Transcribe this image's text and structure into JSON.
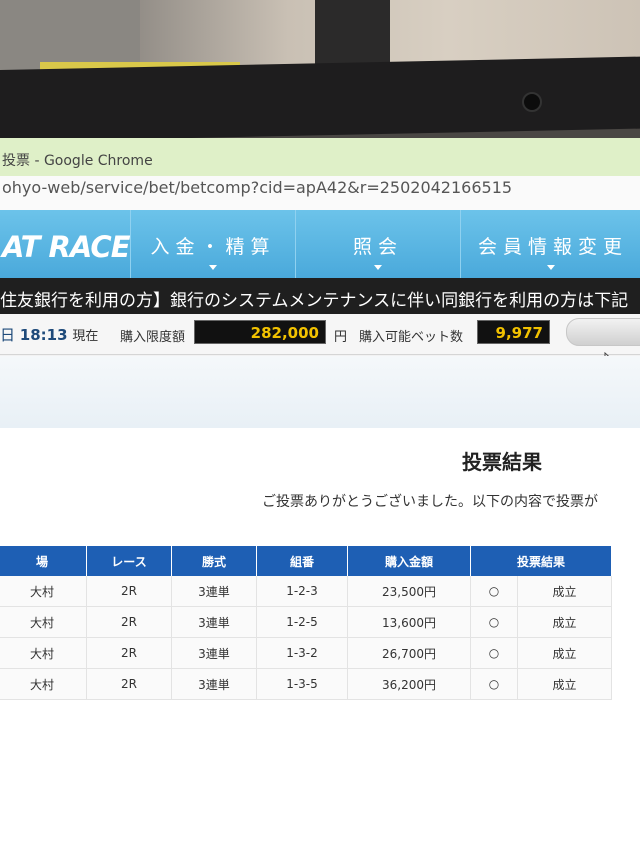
{
  "window": {
    "title": "投票 - Google Chrome",
    "url": "ohyo-web/service/bet/betcomp?cid=apA42&r=2502042166515"
  },
  "site": {
    "logo": "AT RACE",
    "nav": [
      "入金・精算",
      "照会",
      "会員情報変更"
    ]
  },
  "ticker": "住友銀行を利用の方】銀行のシステムメンテナンスに伴い同銀行を利用の方は下記",
  "status_bar": {
    "day_suffix": "日",
    "time": "18:13",
    "now_label": "現在",
    "limit_label": "購入限度額",
    "limit_value": "282,000",
    "yen": "円",
    "bets_label": "購入可能ベット数",
    "bets_value": "9,977"
  },
  "result": {
    "title": "投票結果",
    "message": "ご投票ありがとうございました。以下の内容で投票が"
  },
  "table": {
    "headers": [
      "場",
      "レース",
      "勝式",
      "組番",
      "購入金額",
      "投票結果"
    ],
    "rows": [
      {
        "venue": "大村",
        "race": "2R",
        "type": "3連単",
        "combo": "1-2-3",
        "amount": "23,500円",
        "mark": "○",
        "status": "成立"
      },
      {
        "venue": "大村",
        "race": "2R",
        "type": "3連単",
        "combo": "1-2-5",
        "amount": "13,600円",
        "mark": "○",
        "status": "成立"
      },
      {
        "venue": "大村",
        "race": "2R",
        "type": "3連単",
        "combo": "1-3-2",
        "amount": "26,700円",
        "mark": "○",
        "status": "成立"
      },
      {
        "venue": "大村",
        "race": "2R",
        "type": "3連単",
        "combo": "1-3-5",
        "amount": "36,200円",
        "mark": "○",
        "status": "成立"
      }
    ]
  }
}
